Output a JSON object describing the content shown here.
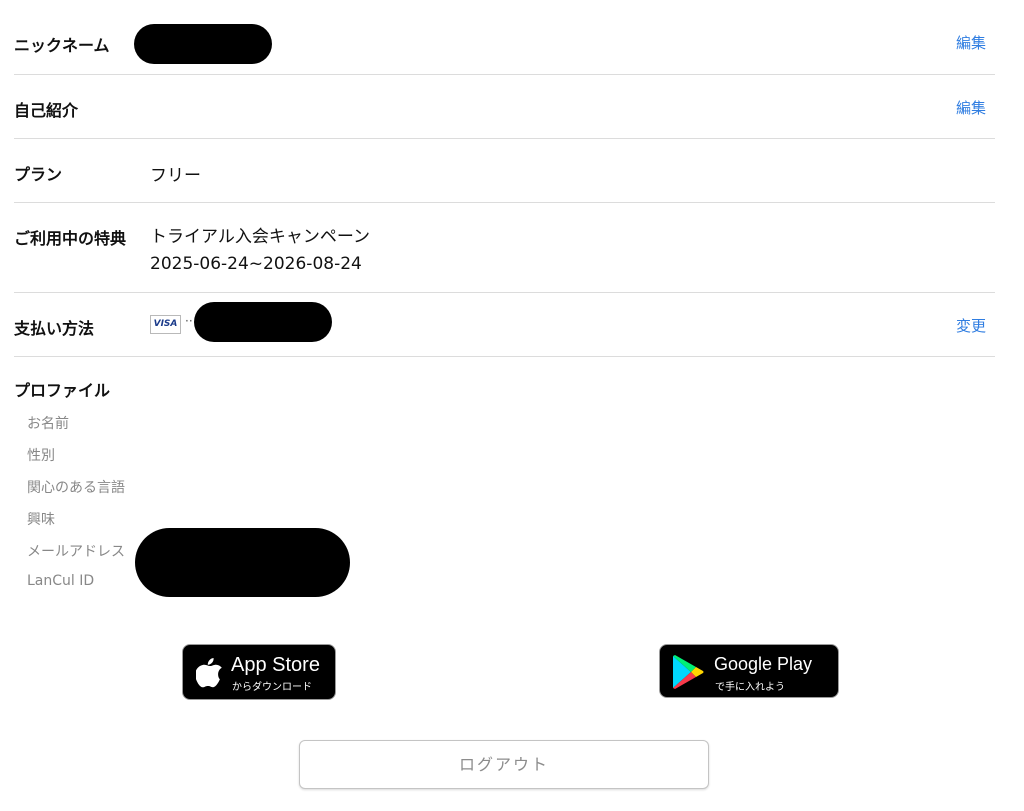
{
  "account": {
    "nickname": {
      "label": "ニックネーム",
      "edit": "編集"
    },
    "intro": {
      "label": "自己紹介",
      "edit": "編集"
    },
    "plan": {
      "label": "プラン",
      "value": "フリー"
    },
    "benefit": {
      "label": "ご利用中の特典",
      "name": "トライアル入会キャンペーン",
      "period": "2025-06-24~2026-08-24"
    },
    "payment": {
      "label": "支払い方法",
      "card_brand": "VISA",
      "card_dots": "··",
      "change": "変更"
    }
  },
  "profile": {
    "title": "プロファイル",
    "fields": [
      "お名前",
      "性別",
      "関心のある言語",
      "興味",
      "メールアドレス",
      "LanCul ID"
    ]
  },
  "stores": {
    "appstore": {
      "main": "App Store",
      "sub": "からダウンロード",
      "icon": "apple-icon"
    },
    "googleplay": {
      "main": "Google Play",
      "sub": "で手に入れよう",
      "icon": "google-play-icon"
    }
  },
  "logout_label": "ログアウト",
  "colors": {
    "link": "#2f7de1",
    "divider": "#dcdcdc",
    "muted": "#888888"
  }
}
